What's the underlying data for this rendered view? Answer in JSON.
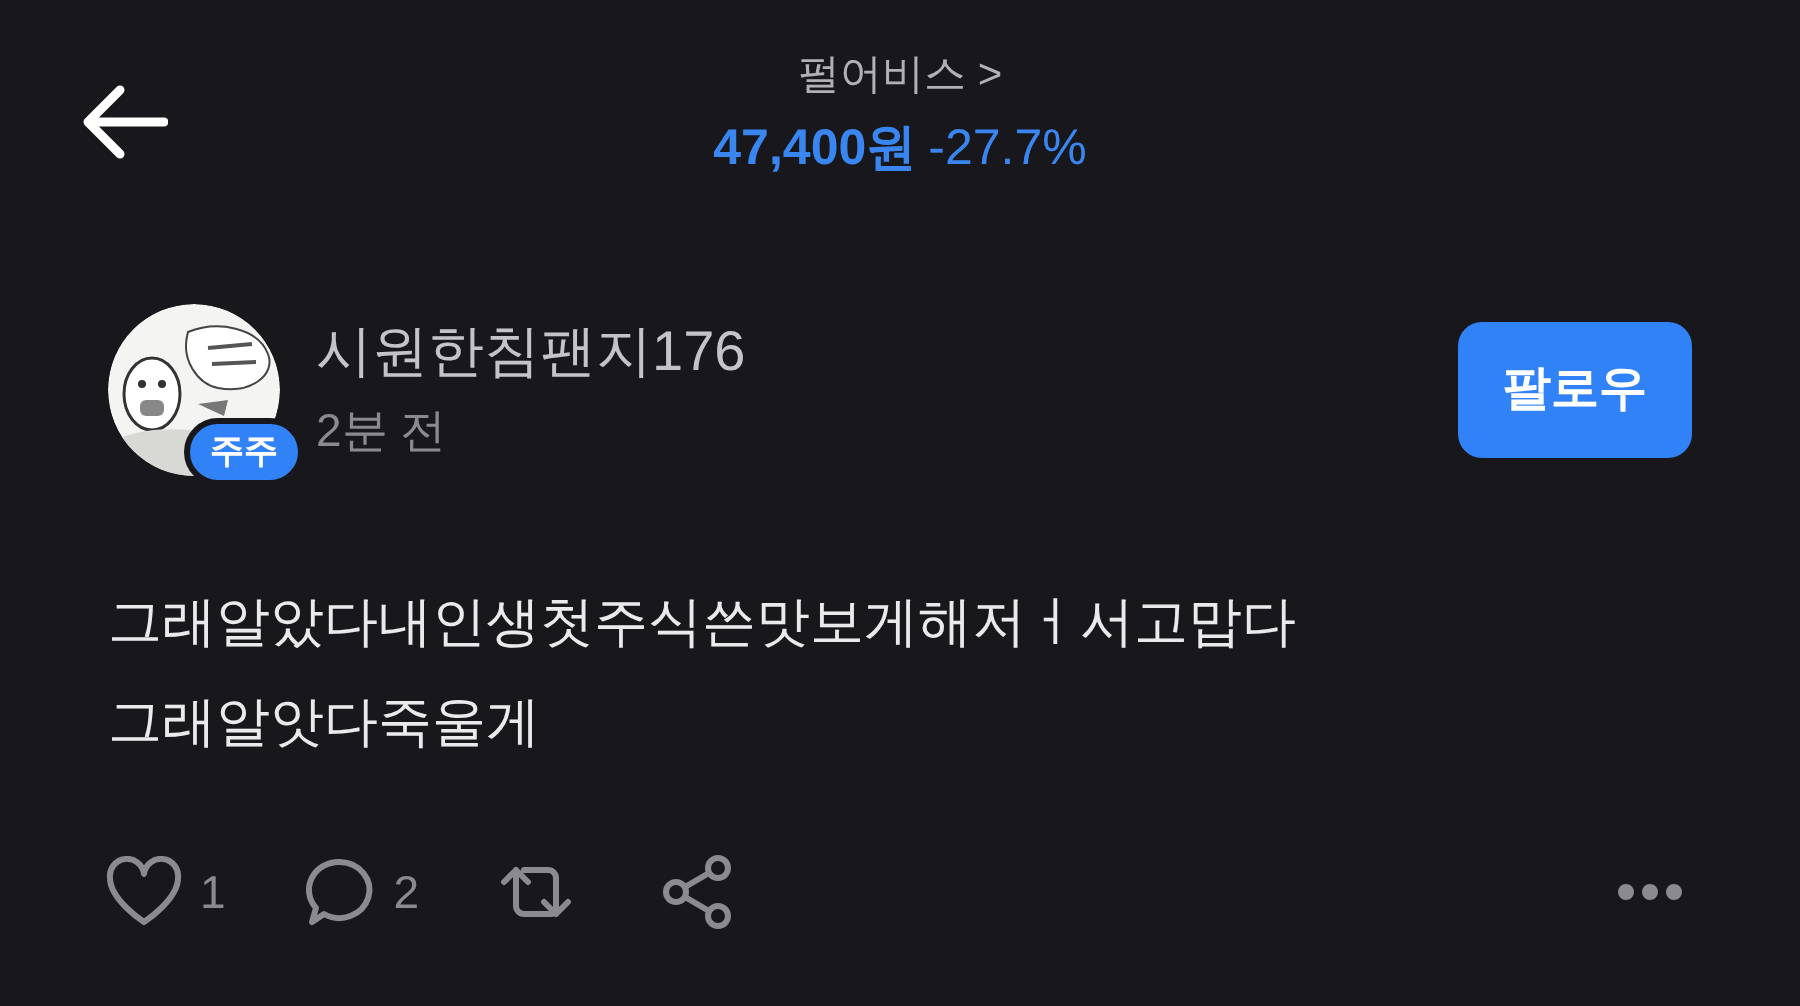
{
  "header": {
    "stock_name": "펄어비스",
    "chevron": ">",
    "price": "47,400원",
    "change": "-27.7%"
  },
  "post": {
    "author": "시원한침팬지176",
    "badge": "주주",
    "time": "2분 전",
    "follow_label": "팔로우",
    "lines": [
      "그래알았다내인생첫주식쓴맛보게해저ㅓ서고맙다",
      "그래알앗다죽울게"
    ],
    "likes": "1",
    "comments": "2"
  }
}
